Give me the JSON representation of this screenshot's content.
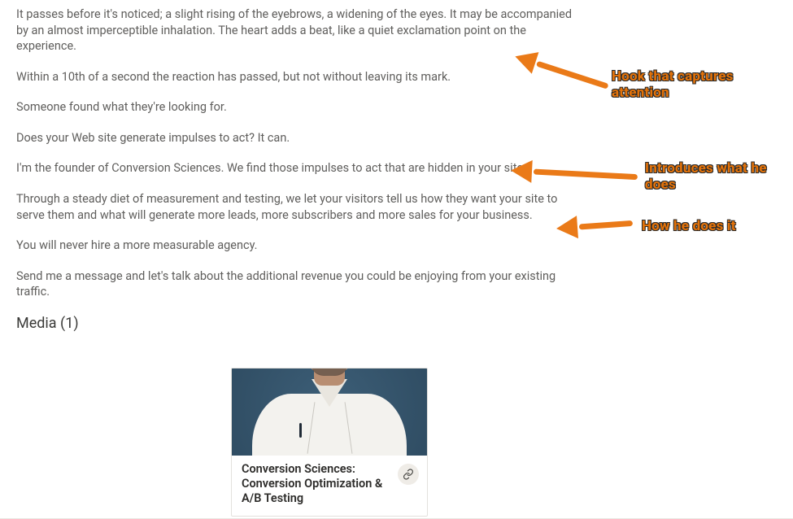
{
  "colors": {
    "body_text": "#5f5e5c",
    "heading_text": "#3a3a38",
    "annotation": "#e2720a",
    "arrow": "#ea7a18"
  },
  "paragraphs": [
    "It passes before it's noticed; a slight rising of the eyebrows, a widening of the eyes. It may be accompanied by an almost imperceptible inhalation. The heart adds a beat, like a quiet exclamation point on the experience.",
    "Within a 10th of a second the reaction has passed, but not without leaving its mark.",
    "Someone found what they're looking for.",
    "Does your Web site generate impulses to act? It can.",
    "I'm the founder of Conversion Sciences. We find those impulses to act that are hidden in your site.",
    "Through a steady diet of measurement and testing, we let your visitors tell us how they want your site to serve them and what will generate more leads, more subscribers and more sales for your business.",
    "You will never hire a more measurable agency.",
    "Send me a message and let's talk about the additional revenue you could be enjoying from your existing traffic."
  ],
  "media": {
    "heading": "Media (1)",
    "count": 1,
    "card_title": "Conversion Sciences: Conversion Optimization & A/B Testing",
    "icon_name": "link-icon"
  },
  "annotations": [
    {
      "id": "hook",
      "text": "Hook that captures attention"
    },
    {
      "id": "intro",
      "text": "Introduces what he does"
    },
    {
      "id": "how",
      "text": "How he does it"
    }
  ]
}
